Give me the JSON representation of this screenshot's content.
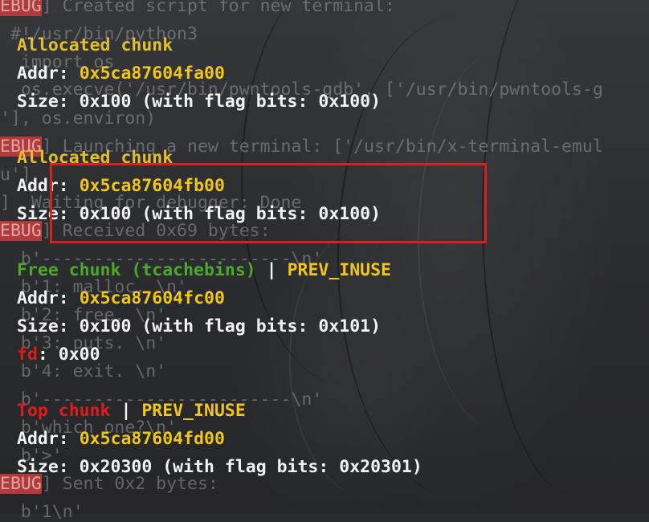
{
  "ghost_lines": [
    {
      "tag": "EBUG",
      "text": "] Created script for new terminal:"
    },
    {
      "tag": "",
      "text": " #!/usr/bin/python3"
    },
    {
      "tag": "",
      "text": "  import os"
    },
    {
      "tag": "",
      "text": "  os.execve('/usr/bin/pwntools-gdb', ['/usr/bin/pwntools-g"
    },
    {
      "tag": "",
      "text": "'], os.environ)"
    },
    {
      "tag": "EBUG",
      "text": "] Launching a new terminal: ['/usr/bin/x-terminal-emul"
    },
    {
      "tag": "",
      "text": "u']"
    },
    {
      "tag": "",
      "text": "]  Waiting for debugger: Done"
    },
    {
      "tag": "EBUG",
      "text": "] Received 0x69 bytes:"
    },
    {
      "tag": "",
      "text": "  b'------------------------\\n'"
    },
    {
      "tag": "",
      "text": "  b'1: malloc. \\n'"
    },
    {
      "tag": "",
      "text": "  b'2: free. \\n'"
    },
    {
      "tag": "",
      "text": "  b'3: puts. \\n'"
    },
    {
      "tag": "",
      "text": "  b'4: exit. \\n'"
    },
    {
      "tag": "",
      "text": "  b'------------------------\\n'"
    },
    {
      "tag": "",
      "text": "  b'which one?\\n'"
    },
    {
      "tag": "",
      "text": "  b'>'"
    },
    {
      "tag": "EBUG",
      "text": "] Sent 0x2 bytes:"
    },
    {
      "tag": "",
      "text": "  b'1\\n'"
    }
  ],
  "chunks": {
    "c1": {
      "header": "Allocated chunk",
      "addr_label": "Addr:",
      "addr": "0x5ca87604fa00",
      "size_text": "Size: 0x100 (with flag bits: 0x100)"
    },
    "c2": {
      "header": "Allocated chunk",
      "addr_label": "Addr:",
      "addr": "0x5ca87604fb00",
      "size_text": "Size: 0x100 (with flag bits: 0x100)"
    },
    "c3": {
      "header": "Free chunk (tcachebins)",
      "sep": " | ",
      "flag": "PREV_INUSE",
      "addr_label": "Addr:",
      "addr": "0x5ca87604fc00",
      "size_text": "Size: 0x100 (with flag bits: 0x101)",
      "fd_label": "fd",
      "fd_value": ": 0x00"
    },
    "c4": {
      "header": "Top chunk",
      "sep": " | ",
      "flag": "PREV_INUSE",
      "addr_label": "Addr:",
      "addr": "0x5ca87604fd00",
      "size_text": "Size: 0x20300 (with flag bits: 0x20301)"
    }
  },
  "colors": {
    "allocated": "#f0c51d",
    "free": "#4fa82c",
    "top": "#e01b1b",
    "highlight": "#d91f1f"
  }
}
